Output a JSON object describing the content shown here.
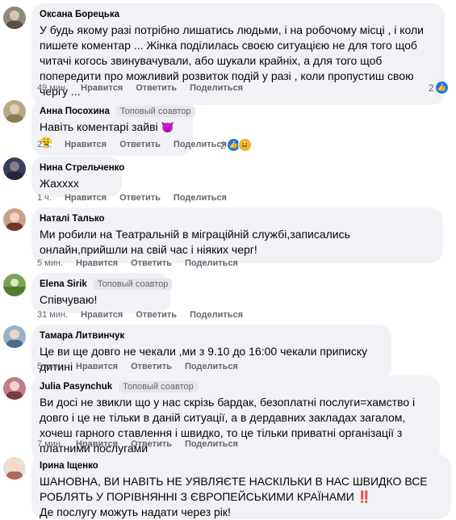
{
  "actions": {
    "like": "Нравится",
    "reply": "Ответить",
    "share": "Поделиться"
  },
  "top_fan_label": "Топовый соавтор",
  "comments": [
    {
      "author": "Оксана Борецька",
      "text": "У будь якому разі потрібно лишатись людьми, і на робочому місці , і коли пишете коментар ... Жінка поділилась своєю ситуацією не для того щоб читачі когось звинувачували, або шукали крайніх, а для того щоб попередити про можливий розвиток подій у разі , коли пропустиш свою чергу ...",
      "time": "49 мин.",
      "reaction_count": "2"
    },
    {
      "author": "Анна Посохина",
      "text": "Навіть коментарі зайві",
      "emoji": "😈😤",
      "time": "2 ч.",
      "reaction_count": "2"
    },
    {
      "author": "Нина Стрельченко",
      "text": "Жахххх",
      "time": "1 ч."
    },
    {
      "author": "Наталі Талько",
      "text": "Ми робили на Театральній в міграційній службі,записались онлайн,прийшли на свій час і ніяких черг!",
      "time": "5 мин."
    },
    {
      "author": "Elena Sirik",
      "text": "Співчуваю!",
      "time": "31 мин."
    },
    {
      "author": "Тамара Литвинчук",
      "text": "Це ви ще довго не чекали ,ми з 9.10 до 16:00 чекали приписку дитині",
      "time": "5 мин."
    },
    {
      "author": "Julia Pasynchuk",
      "text": "Ви досі не звикли що у нас скрізь бардак, безоплатні послуги=хамство і довго і це не тільки в даній ситуації, а в дердавних закладах загалом, хочеш гарного ставлення і швидко, то це тільки приватні організації з платними послугами",
      "time": "7 мин."
    },
    {
      "author": "Ірина Іщенко",
      "text": "ШАНОВНА, ВИ НАВІТЬ НЕ УЯВЛЯЄТЕ НАСКІЛЬКИ В НАС ШВИДКО ВСЕ РОБЛЯТЬ У ПОРІВНЯННІ З ЄВРОПЕЙСЬКИМИ КРАЇНАМИ",
      "bang": "‼️",
      "text2": "Де послугу можуть надати через рік!"
    }
  ],
  "colors": {
    "bubble": "#f0f2f5",
    "meta": "#65676b",
    "like_blue": "#1877f2"
  }
}
